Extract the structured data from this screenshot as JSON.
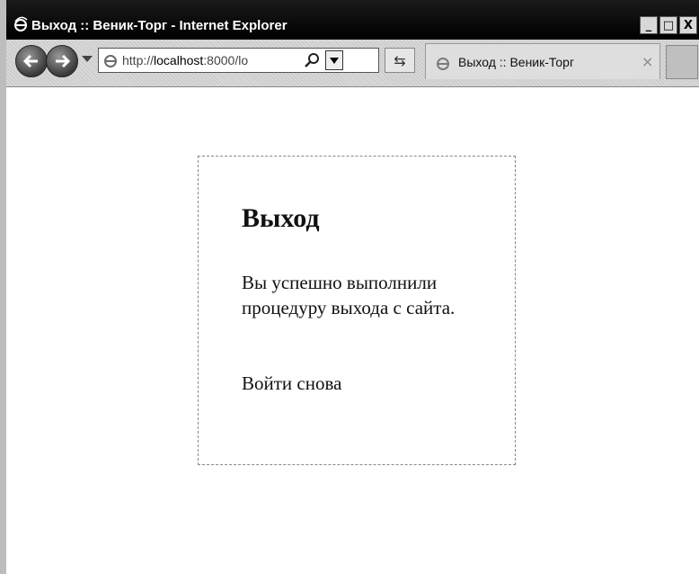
{
  "window": {
    "title": "Выход :: Веник-Торг - Internet Explorer",
    "controls": {
      "minimize": "_",
      "maximize": "□",
      "close": "X"
    }
  },
  "toolbar": {
    "address": {
      "prefix": "http://",
      "host": "localhost",
      "rest": ":8000/lo"
    },
    "compat_glyph": "⇆",
    "tab": {
      "label": "Выход :: Веник-Торг",
      "close": "×"
    }
  },
  "page": {
    "heading": "Выход",
    "message": "Вы успешно выполнили процедуру выхода с сайта.",
    "login_again_link": "Войти снова"
  }
}
